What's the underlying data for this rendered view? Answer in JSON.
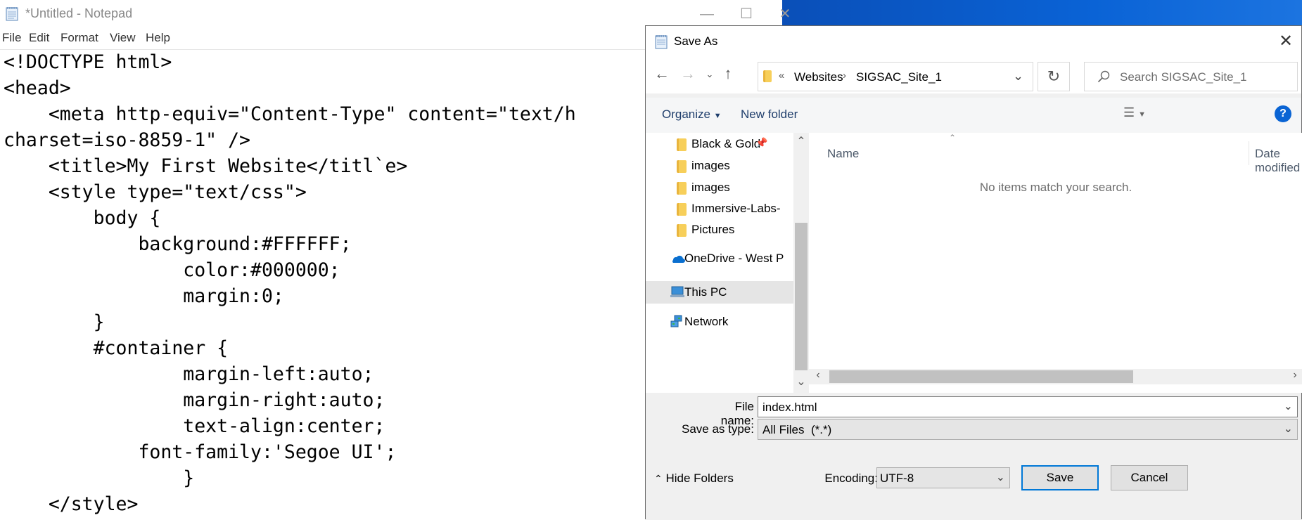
{
  "notepad": {
    "title": "*Untitled - Notepad",
    "menu": [
      "File",
      "Edit",
      "Format",
      "View",
      "Help"
    ],
    "code_lines": [
      "<!DOCTYPE html>",
      "<head>",
      "    <meta http-equiv=\"Content-Type\" content=\"text/h",
      "charset=iso-8859-1\" />",
      "    <title>My First Website</titl`e>",
      "    <style type=\"text/css\">",
      "        body {",
      "            background:#FFFFFF;",
      "                color:#000000;",
      "                margin:0;",
      "        }",
      "        #container {",
      "                margin-left:auto;",
      "                margin-right:auto;",
      "                text-align:center;",
      "            font-family:'Segoe UI';",
      "                }",
      "    </style>"
    ]
  },
  "dialog": {
    "title": "Save As",
    "breadcrumb": [
      "«",
      "Websites",
      "SIGSAC_Site_1"
    ],
    "search_placeholder": "Search SIGSAC_Site_1",
    "toolbar": {
      "organize": "Organize",
      "new_folder": "New folder"
    },
    "nav_items": [
      {
        "label": "Black & Gold",
        "icon": "folder-icon",
        "pinned": true
      },
      {
        "label": "images",
        "icon": "folder-icon"
      },
      {
        "label": "images",
        "icon": "folder-icon"
      },
      {
        "label": "Immersive-Labs-",
        "icon": "folder-icon"
      },
      {
        "label": "Pictures",
        "icon": "folder-icon"
      },
      {
        "label": "OneDrive - West P",
        "icon": "onedrive-icon"
      },
      {
        "label": "This PC",
        "icon": "computer-icon",
        "selected": true
      },
      {
        "label": "Network",
        "icon": "network-icon"
      }
    ],
    "columns": [
      "Name",
      "Date modified"
    ],
    "empty_message": "No items match your search.",
    "file_name_label": "File name:",
    "file_name_value": "index.html",
    "save_type_label": "Save as type:",
    "save_type_value": "All Files  (*.*)",
    "hide_folders": "Hide Folders",
    "encoding_label": "Encoding:",
    "encoding_value": "UTF-8",
    "save_button": "Save",
    "cancel_button": "Cancel"
  },
  "colors": {
    "accent": "#0078d7",
    "desktop": "#0a63d6",
    "selection": "#e5e5e5"
  }
}
